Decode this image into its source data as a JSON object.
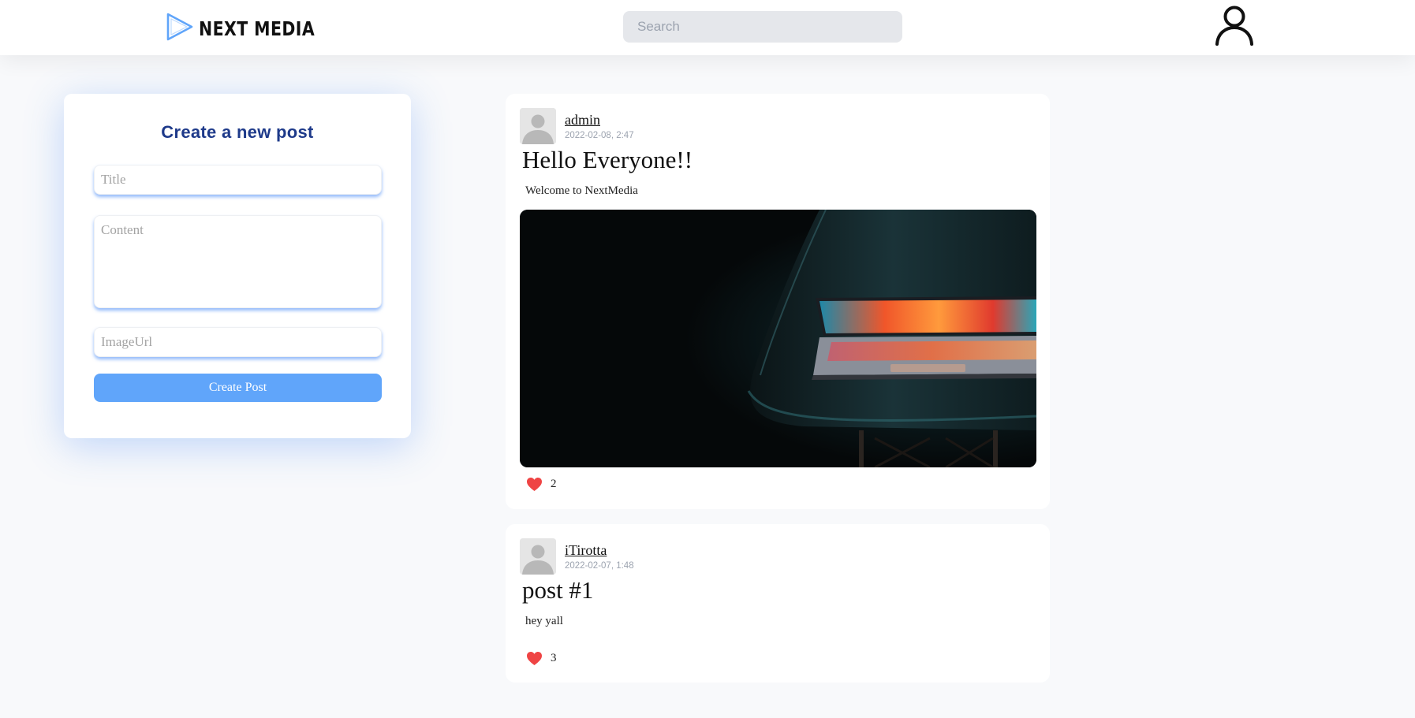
{
  "header": {
    "brand": "NEXT MEDIA",
    "search_placeholder": "Search",
    "brand_color": "#3b82f6"
  },
  "create_post": {
    "heading": "Create a new post",
    "title_placeholder": "Title",
    "content_placeholder": "Content",
    "image_placeholder": "ImageUrl",
    "submit_label": "Create Post",
    "accent_color": "#60a5fa",
    "heading_color": "#1e3a8a"
  },
  "posts": [
    {
      "author": "admin",
      "timestamp": "2022-02-08, 2:47",
      "title": "Hello Everyone!!",
      "content": "Welcome to NextMedia",
      "has_image": true,
      "image_description_icon": "laptop-on-chair-photo",
      "likes": "2"
    },
    {
      "author": "iTirotta",
      "timestamp": "2022-02-07, 1:48",
      "title": "post #1",
      "content": "hey yall",
      "has_image": false,
      "likes": "3"
    }
  ],
  "icons": {
    "logo": "play-triangle-icon",
    "profile": "user-icon",
    "avatar": "default-avatar-icon",
    "like": "heart-icon"
  },
  "colors": {
    "heart": "#ef4444",
    "page_bg": "#f8f9fb",
    "search_bg": "#e5e7eb"
  }
}
